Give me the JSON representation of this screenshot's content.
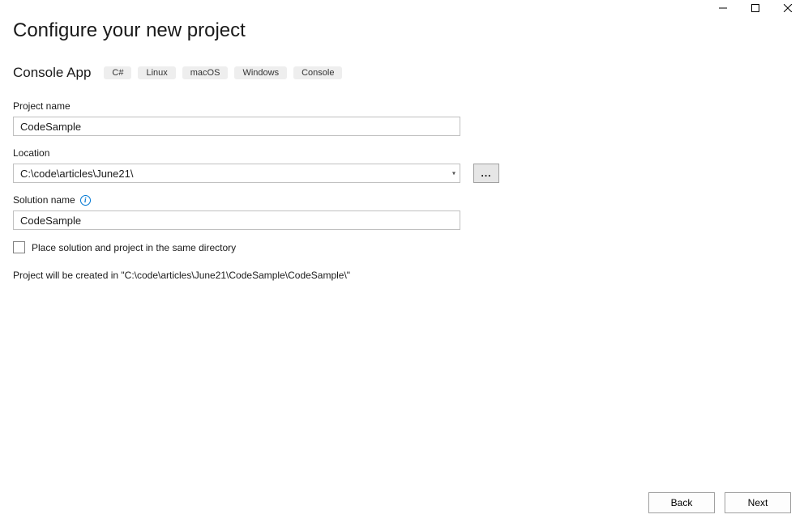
{
  "titlebar": {
    "minimize_glyph": "─",
    "maximize_glyph": "☐",
    "close_glyph": "✕"
  },
  "page_title": "Configure your new project",
  "template": {
    "name": "Console App",
    "tags": [
      "C#",
      "Linux",
      "macOS",
      "Windows",
      "Console"
    ]
  },
  "fields": {
    "project_name_label": "Project name",
    "project_name_value": "CodeSample",
    "location_label": "Location",
    "location_value": "C:\\code\\articles\\June21\\",
    "browse_label": "...",
    "solution_name_label": "Solution name",
    "solution_name_value": "CodeSample",
    "same_dir_label": "Place solution and project in the same directory"
  },
  "path_preview": "Project will be created in \"C:\\code\\articles\\June21\\CodeSample\\CodeSample\\\"",
  "footer": {
    "back_label": "Back",
    "next_label": "Next"
  }
}
